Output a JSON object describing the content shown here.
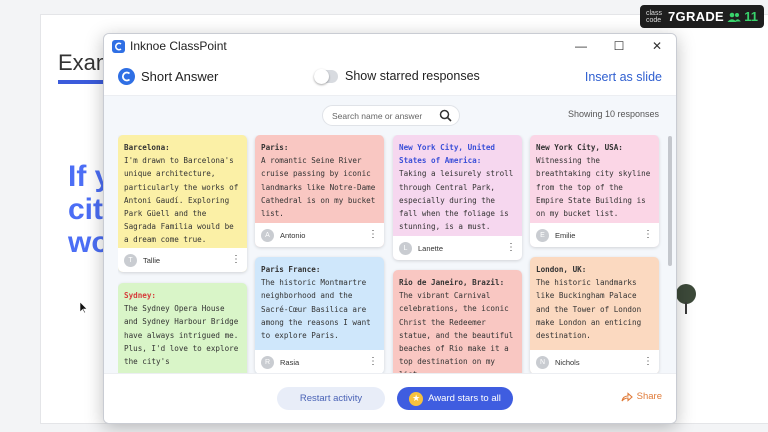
{
  "slide": {
    "title": "Exam",
    "big_text": [
      "If y",
      "cit",
      "wo"
    ]
  },
  "grade_badge": {
    "class_code_label": "class code",
    "name": "7GRADE",
    "count": "11"
  },
  "window": {
    "title": "Inknoe ClassPoint"
  },
  "header": {
    "title": "Short Answer",
    "toggle_label": "Show starred responses",
    "insert_label": "Insert as slide"
  },
  "search": {
    "placeholder": "Search name or answer",
    "showing": "Showing 10 responses"
  },
  "cards": [
    {
      "loc": "Barcelona:",
      "loc_color": "#333333",
      "bg": "#fbf0a6",
      "text": "I'm drawn to Barcelona's unique architecture, particularly the works of Antoni Gaudí. Exploring Park Güell and the Sagrada Familia would be a dream come true.",
      "user": "Tallie",
      "initial": "T"
    },
    {
      "loc": "Paris:",
      "loc_color": "#333333",
      "bg": "#f9c7c2",
      "text": "A romantic Seine River cruise passing by iconic landmarks like Notre-Dame Cathedral is on my bucket list.",
      "user": "Antonio",
      "initial": "A"
    },
    {
      "loc": "New York City, United States of America:",
      "loc_color": "#3b4fd8",
      "bg": "#f6d7ef",
      "text": "Taking a leisurely stroll through Central Park, especially during the fall when the foliage is stunning, is a must.",
      "user": "Lanette",
      "initial": "L"
    },
    {
      "loc": "New York City, USA:",
      "loc_color": "#333333",
      "bg": "#fbd6e6",
      "text": "Witnessing the breathtaking city skyline from the top of the Empire State Building is on my bucket list.",
      "user": "Emilie",
      "initial": "E"
    },
    {
      "loc": "Sydney:",
      "loc_color": "#d63a3a",
      "bg": "#d9f5c8",
      "text": "The Sydney Opera House and Sydney Harbour Bridge have always intrigued me. Plus, I'd love to explore the city's",
      "user": "",
      "initial": ""
    },
    {
      "loc": "Paris France:",
      "loc_color": "#333333",
      "bg": "#cfe7fb",
      "text": "The historic Montmartre neighborhood and the Sacré-Cœur Basilica are among the reasons I want to explore Paris.",
      "user": "Rasia",
      "initial": "R"
    },
    {
      "loc": "Rio de Janeiro, Brazil:",
      "loc_color": "#333333",
      "bg": "#f9c7c2",
      "text": "The vibrant Carnival celebrations, the iconic Christ the Redeemer statue, and the beautiful beaches of Rio make it a top destination on my list.",
      "user": "",
      "initial": ""
    },
    {
      "loc": "London, UK:",
      "loc_color": "#333333",
      "bg": "#fbd9c0",
      "text": "The historic landmarks like Buckingham Palace and the Tower of London make London an enticing destination.",
      "user": "Nichols",
      "initial": "N"
    }
  ],
  "bottom": {
    "restart_label": "Restart activity",
    "award_label": "Award stars to all",
    "share_label": "Share"
  },
  "colors": {
    "accent": "#3f5de0",
    "share": "#e07b39"
  }
}
